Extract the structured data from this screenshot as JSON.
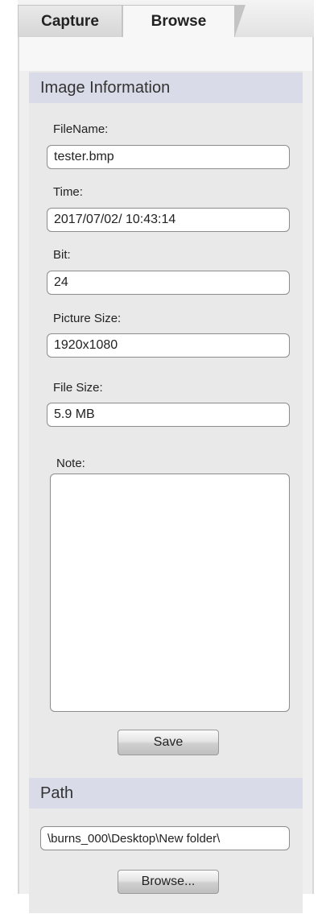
{
  "tabs": {
    "capture": "Capture",
    "browse": "Browse",
    "active": "Browse"
  },
  "image_info": {
    "header": "Image Information",
    "filename_label": "FileName:",
    "filename_value": "tester.bmp",
    "time_label": "Time:",
    "time_value": "2017/07/02/ 10:43:14",
    "bit_label": "Bit:",
    "bit_value": "24",
    "picture_size_label": "Picture Size:",
    "picture_size_value": "1920x1080",
    "file_size_label": "File Size:",
    "file_size_value": "5.9 MB",
    "note_label": "Note:",
    "note_value": "",
    "save_label": "Save"
  },
  "path": {
    "header": "Path",
    "value": "\\burns_000\\Desktop\\New folder\\",
    "browse_label": "Browse..."
  },
  "colors": {
    "section_header_bg": "#d9dce8",
    "panel_bg": "#efefef"
  }
}
